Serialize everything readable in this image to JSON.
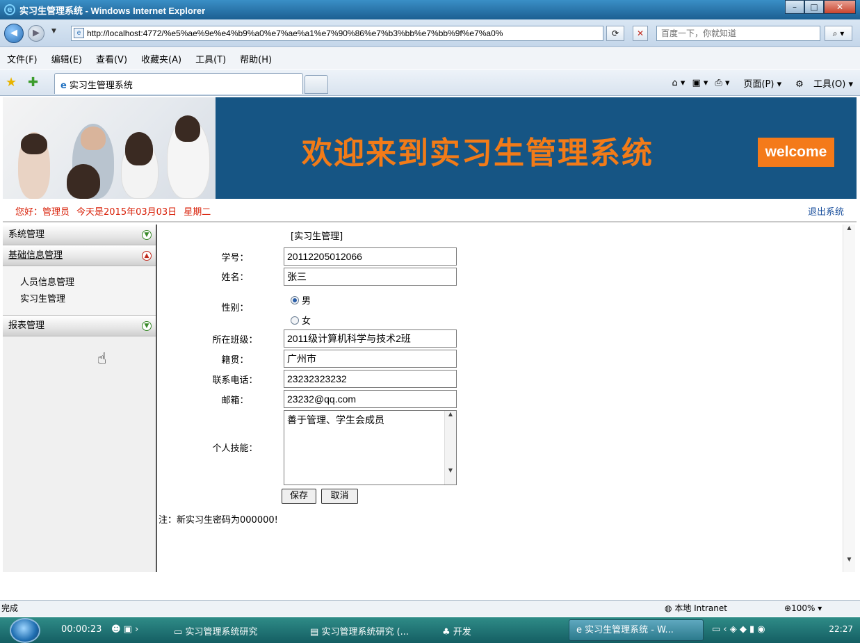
{
  "window": {
    "title": "实习生管理系统 - Windows Internet Explorer",
    "controls": {
      "minimize": "–",
      "maximize": "□",
      "close": "✕"
    }
  },
  "address": {
    "url": "http://localhost:4772/%e5%ae%9e%e4%b9%a0%e7%ae%a1%e7%90%86%e7%b3%bb%e7%bb%9f%e7%a0%",
    "search_placeholder": "百度一下，你就知道"
  },
  "menu": [
    "文件(F)",
    "编辑(E)",
    "查看(V)",
    "收藏夹(A)",
    "工具(T)",
    "帮助(H)"
  ],
  "tabbar": {
    "tab_title": "实习生管理系统",
    "page_menu": "页面(P)",
    "tools_menu": "工具(O)"
  },
  "banner": {
    "title": "欢迎来到实习生管理系统",
    "welcome": "welcome",
    "colors": {
      "background": "#165584",
      "accent": "#f27b18"
    }
  },
  "infobar": {
    "greeting": "您好：管理员",
    "date": "今天是2015年03月03日",
    "weekday": "星期二",
    "logout": "退出系统"
  },
  "sidebar": {
    "sections": [
      {
        "label": "系统管理"
      },
      {
        "label": "基础信息管理",
        "items": [
          "人员信息管理",
          "实习生管理"
        ]
      },
      {
        "label": "报表管理"
      }
    ]
  },
  "form": {
    "title": "[实习生管理]",
    "student_id": {
      "label": "学号：",
      "value": "20112205012066"
    },
    "name": {
      "label": "姓名：",
      "value": "张三"
    },
    "gender": {
      "label": "性别：",
      "options": [
        "男",
        "女"
      ],
      "selected": "男"
    },
    "class": {
      "label": "所在班级：",
      "value": "2011级计算机科学与技术2班"
    },
    "hometown": {
      "label": "籍贯：",
      "value": "广州市"
    },
    "phone": {
      "label": "联系电话：",
      "value": "23232323232"
    },
    "email": {
      "label": "邮箱：",
      "value": "23232@qq.com"
    },
    "skills": {
      "label": "个人技能：",
      "value": "善于管理、学生会成员"
    },
    "save": "保存",
    "cancel": "取消",
    "note": "注：新实习生密码为000000!"
  },
  "status": {
    "text": "完成",
    "zone": "本地 Intranet",
    "zoom": "100%"
  },
  "taskbar": {
    "timer": "00:00:23",
    "items": [
      "实习管理系统研究",
      "实习管理系统研究 (...",
      "开发"
    ],
    "active": "实习生管理系统 - W...",
    "clock": "22:27"
  }
}
